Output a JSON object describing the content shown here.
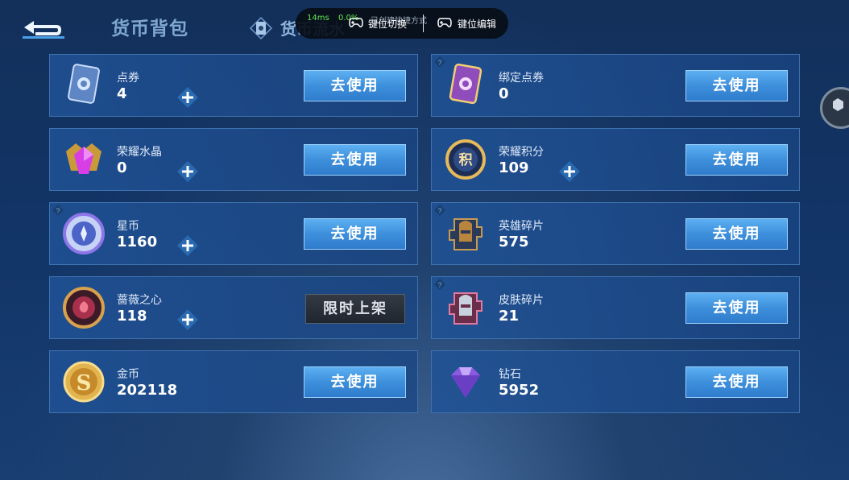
{
  "header": {
    "tab_active": "货币背包",
    "tab_other": "货币流水"
  },
  "overlay": {
    "ping": "14ms",
    "loss": "0.0%",
    "ghost_text": "已创建快捷方式",
    "btn_switch": "键位切换",
    "btn_edit": "键位编辑"
  },
  "currencies": [
    {
      "name": "点券",
      "count": "4",
      "action": "去使用",
      "icon": "ticket-icon"
    },
    {
      "name": "绑定点券",
      "count": "0",
      "action": "去使用",
      "icon": "bound-ticket-icon"
    },
    {
      "name": "荣耀水晶",
      "count": "0",
      "action": "去使用",
      "icon": "glory-crystal-icon"
    },
    {
      "name": "荣耀积分",
      "count": "109",
      "action": "去使用",
      "icon": "glory-points-icon"
    },
    {
      "name": "星币",
      "count": "1160",
      "action": "去使用",
      "icon": "star-coin-icon"
    },
    {
      "name": "英雄碎片",
      "count": "575",
      "action": "去使用",
      "icon": "hero-fragment-icon"
    },
    {
      "name": "蔷薇之心",
      "count": "118",
      "action": "限时上架",
      "icon": "rose-heart-icon"
    },
    {
      "name": "皮肤碎片",
      "count": "21",
      "action": "去使用",
      "icon": "skin-fragment-icon"
    },
    {
      "name": "金币",
      "count": "202118",
      "action": "去使用",
      "icon": "gold-coin-icon"
    },
    {
      "name": "钻石",
      "count": "5952",
      "action": "去使用",
      "icon": "diamond-icon"
    }
  ],
  "colors": {
    "accent": "#3d8fdb",
    "panel": "#1f5394",
    "background": "#13305a"
  }
}
